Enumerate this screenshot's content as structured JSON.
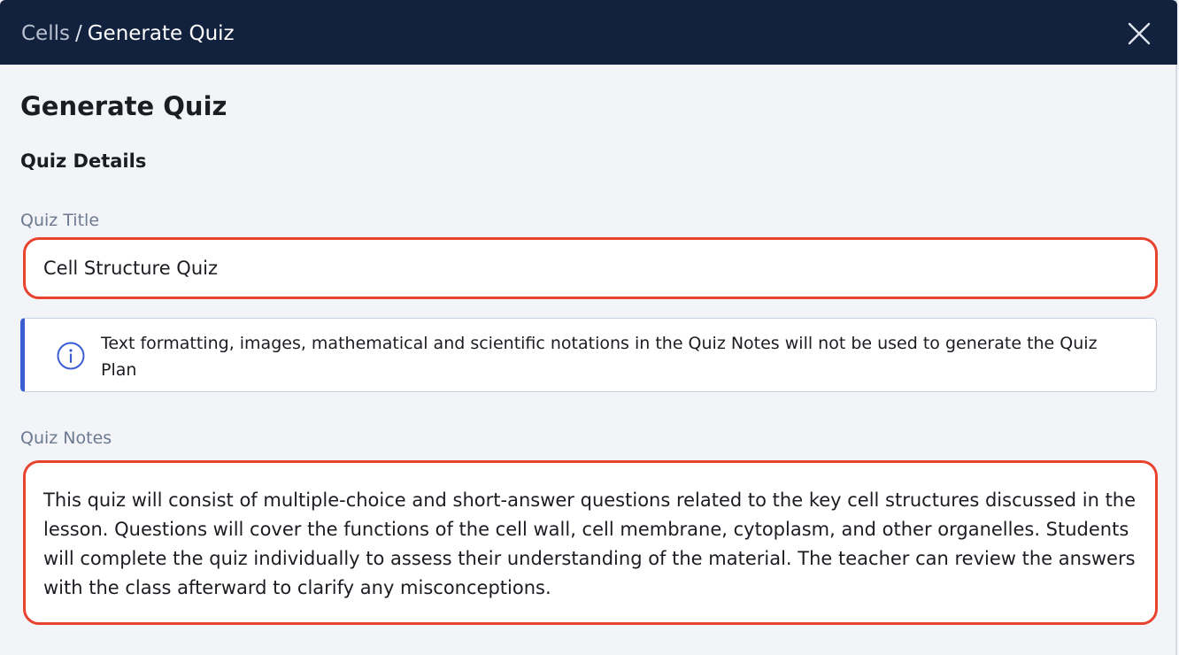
{
  "header": {
    "breadcrumb_parent": "Cells",
    "breadcrumb_separator": "/",
    "breadcrumb_current": "Generate Quiz",
    "close_icon": "close-icon",
    "background_color": "#12213d"
  },
  "page": {
    "title": "Generate Quiz",
    "section_title": "Quiz Details"
  },
  "quiz_title": {
    "label": "Quiz Title",
    "value": "Cell Structure Quiz"
  },
  "info": {
    "icon": "info-icon",
    "text": "Text formatting, images, mathematical and scientific notations in the Quiz Notes will not be used to generate the Quiz Plan",
    "accent_color": "#3b5fd3"
  },
  "quiz_notes": {
    "label": "Quiz Notes",
    "value": "This quiz will consist of multiple-choice and short-answer questions related to the key cell structures discussed in the lesson. Questions will cover the functions of the cell wall, cell membrane, cytoplasm, and other organelles. Students will complete the quiz individually to assess their understanding of the material. The teacher can review the answers with the class afterward to clarify any misconceptions."
  },
  "highlight_color": "#e8432f"
}
